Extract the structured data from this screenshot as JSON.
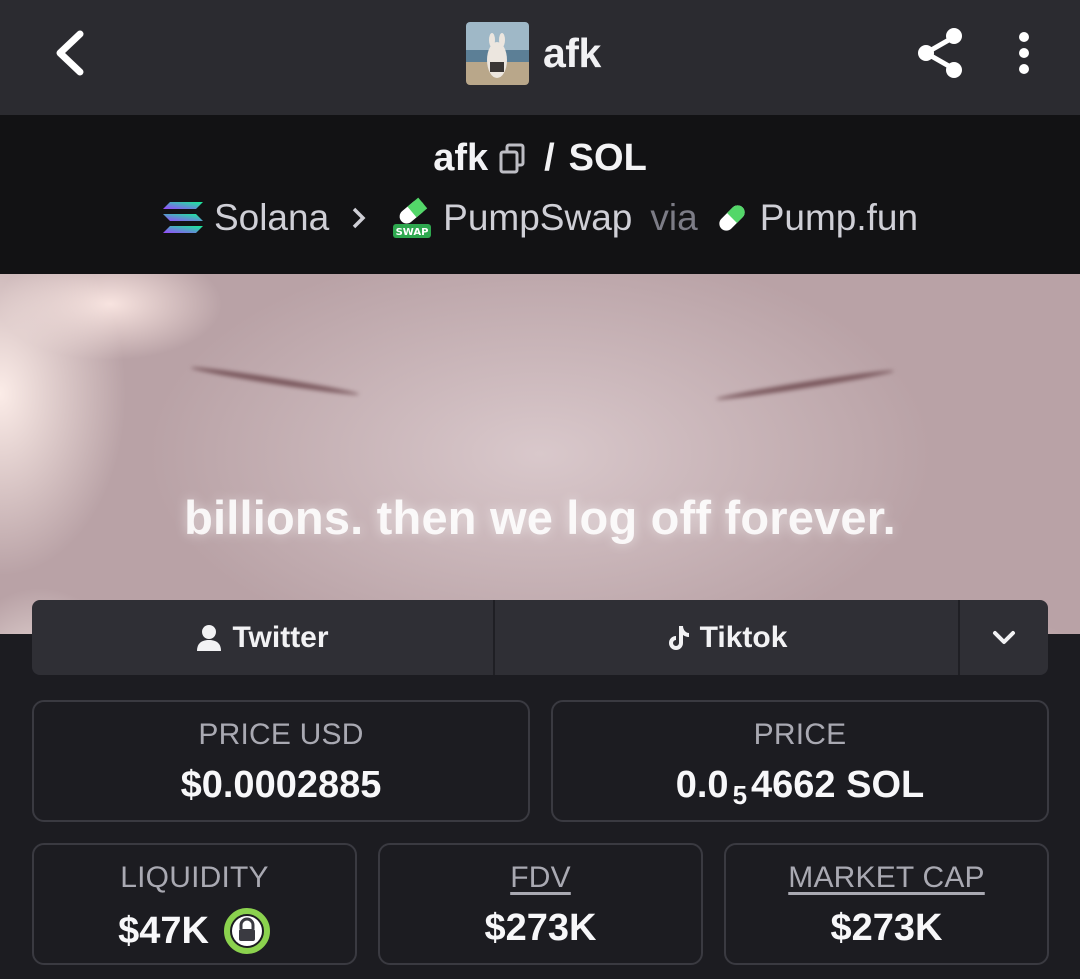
{
  "appbar": {
    "title": "afk"
  },
  "pair": {
    "base": "afk",
    "separator": "/",
    "quote": "SOL",
    "chain": "Solana",
    "dex": "PumpSwap",
    "via_label": "via",
    "launchpad": "Pump.fun"
  },
  "banner": {
    "caption": "billions. then we log off forever."
  },
  "social": {
    "twitter_label": "Twitter",
    "tiktok_label": "Tiktok"
  },
  "stats": {
    "price_usd_label": "PRICE USD",
    "price_usd_value": "$0.0002885",
    "price_label": "PRICE",
    "price_value_prefix": "0.0",
    "price_value_zeros": "5",
    "price_value_suffix": "4662 SOL",
    "liquidity_label": "LIQUIDITY",
    "liquidity_value": "$47K",
    "fdv_label": "FDV",
    "fdv_value": "$273K",
    "mcap_label": "MARKET CAP",
    "mcap_value": "$273K"
  },
  "icons": {
    "back": "chevron-left-icon",
    "share": "share-icon",
    "more": "more-vertical-icon",
    "copy": "copy-icon",
    "solana": "solana-icon",
    "pumpswap": "pumpswap-icon",
    "pumpfun": "pumpfun-pill-icon",
    "twitter": "user-icon",
    "tiktok": "tiktok-icon",
    "expand": "chevron-down-icon",
    "lock": "lock-icon"
  },
  "colors": {
    "appbar_bg": "#2b2b30",
    "header_bg": "#121214",
    "page_bg": "#1c1c21",
    "card_border": "#3a3a41",
    "lock_green": "#8bd24e"
  },
  "swap_badge_text": "SWAP"
}
